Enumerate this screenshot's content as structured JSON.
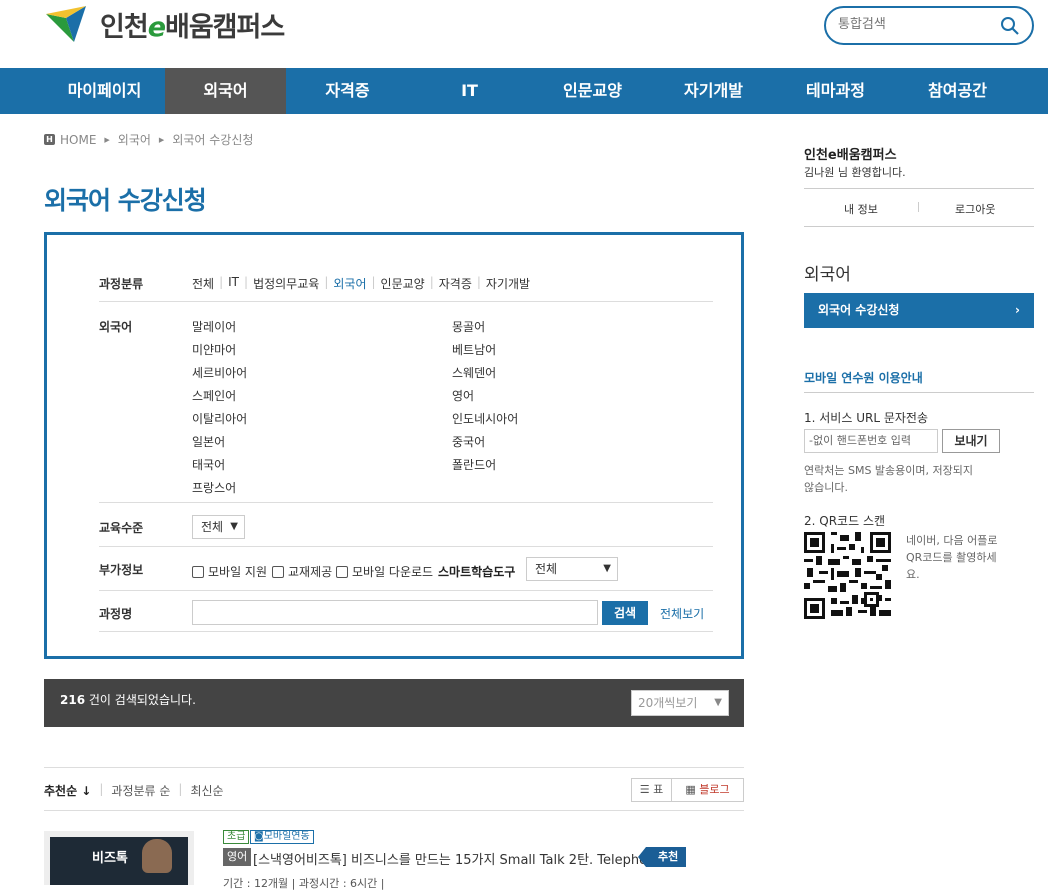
{
  "header": {
    "logo_prefix": "인천",
    "logo_e": "e",
    "logo_suffix": "배움캠퍼스",
    "search_placeholder": "통합검색"
  },
  "gnb": [
    "마이페이지",
    "외국어",
    "자격증",
    "IT",
    "인문교양",
    "자기개발",
    "테마과정",
    "참여공간"
  ],
  "breadcrumb": {
    "home": "HOME",
    "level1": "외국어",
    "level2": "외국어 수강신청"
  },
  "page_title": "외국어 수강신청",
  "filter": {
    "category_label": "과정분류",
    "categories": [
      "전체",
      "IT",
      "법정의무교육",
      "외국어",
      "인문교양",
      "자격증",
      "자기개발"
    ],
    "language_label": "외국어",
    "languages_left": [
      "말레이어",
      "미얀마어",
      "세르비아어",
      "스페인어",
      "이탈리아어",
      "일본어",
      "태국어",
      "프랑스어"
    ],
    "languages_right": [
      "몽골어",
      "베트남어",
      "스웨덴어",
      "영어",
      "인도네시아어",
      "중국어",
      "폴란드어"
    ],
    "level_label": "교육수준",
    "level_value": "전체",
    "extra_label": "부가정보",
    "extra_checks": [
      "모바일 지원",
      "교재제공",
      "모바일 다운로드"
    ],
    "smart_tool_label": "스마트학습도구",
    "smart_tool_value": "전체",
    "name_label": "과정명",
    "search_button": "검색",
    "view_all": "전체보기"
  },
  "result": {
    "count": "216",
    "text": "건이 검색되었습니다.",
    "per_page": "20개씩보기"
  },
  "sort": {
    "options": [
      "추천순 ↓",
      "과정분류 순",
      "최신순"
    ],
    "view_list": "표",
    "view_blog": "블로그"
  },
  "course": {
    "thumb_text": "비즈톡",
    "level_badge": "초급",
    "mobile_badge": "모바일연동",
    "category": "영어",
    "title": "[스낵영어비즈톡] 비즈니스를 만드는 15가지 Small Talk 2탄. Telephoning",
    "recommend": "추천",
    "meta": "기간 : 12개월  |  과정시간 : 6시간  |"
  },
  "sidebar": {
    "site_name": "인천e배움캠퍼스",
    "welcome": "김나원 님 환영합니다.",
    "my_info": "내 정보",
    "logout": "로그아웃",
    "menu_title": "외국어",
    "menu_active": "외국어 수강신청",
    "mobile_title": "모바일 연수원 이용안내",
    "step1": "1. 서비스 URL 문자전송",
    "phone_placeholder": "-없이 핸드폰번호 입력",
    "send_button": "보내기",
    "sms_note": "연락처는 SMS 발송용이며, 저장되지 않습니다.",
    "step2": "2. QR코드 스캔",
    "qr_note": "네이버, 다음 어플로 QR코드를 촬영하세요."
  },
  "colors": {
    "brand": "#1b6fa8",
    "gnb_active": "#555555",
    "result_bar": "#444444"
  }
}
